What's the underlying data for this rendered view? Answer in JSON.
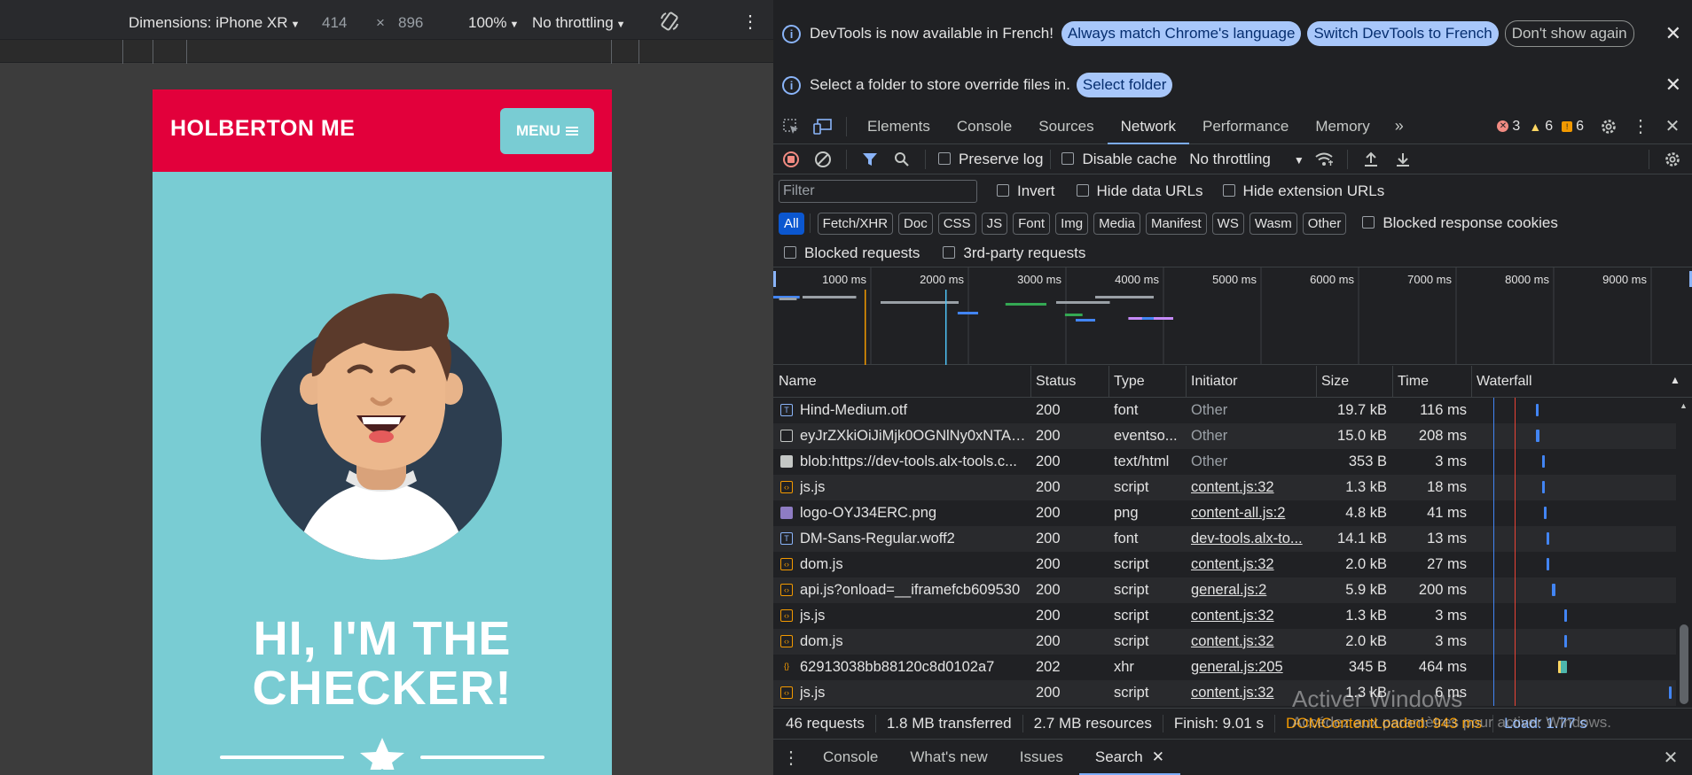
{
  "emulation": {
    "device_label": "Dimensions: iPhone XR",
    "width": "414",
    "times": "×",
    "height": "896",
    "zoom": "100%",
    "throttling": "No throttling"
  },
  "phone": {
    "brand": "HOLBERTON ME",
    "menu_label": "MENU",
    "hero_line1": "HI, I'M THE",
    "hero_line2": "CHECKER!",
    "colors": {
      "header": "#e2003b",
      "background": "#79ccd3"
    }
  },
  "infobars": {
    "language": {
      "message": "DevTools is now available in French!",
      "btn_match": "Always match Chrome's language",
      "btn_switch": "Switch DevTools to French",
      "btn_dismiss": "Don't show again"
    },
    "overrides": {
      "message": "Select a folder to store override files in.",
      "btn_select": "Select folder"
    }
  },
  "tabs": [
    "Elements",
    "Console",
    "Sources",
    "Network",
    "Performance",
    "Memory"
  ],
  "active_tab": "Network",
  "issue_counts": {
    "errors": "3",
    "warnings": "6",
    "info": "6"
  },
  "network_toolbar": {
    "preserve_log": "Preserve log",
    "disable_cache": "Disable cache",
    "throttling": "No throttling"
  },
  "filter": {
    "placeholder": "Filter",
    "invert": "Invert",
    "hide_data_urls": "Hide data URLs",
    "hide_extension_urls": "Hide extension URLs"
  },
  "type_filters": [
    "All",
    "Fetch/XHR",
    "Doc",
    "CSS",
    "JS",
    "Font",
    "Img",
    "Media",
    "Manifest",
    "WS",
    "Wasm",
    "Other"
  ],
  "blocked_response_cookies": "Blocked response cookies",
  "blocked_requests": "Blocked requests",
  "third_party_requests": "3rd-party requests",
  "overview_ticks": [
    "1000 ms",
    "2000 ms",
    "3000 ms",
    "4000 ms",
    "5000 ms",
    "6000 ms",
    "7000 ms",
    "8000 ms",
    "9000 ms"
  ],
  "columns": {
    "name": "Name",
    "status": "Status",
    "type": "Type",
    "initiator": "Initiator",
    "size": "Size",
    "time": "Time",
    "waterfall": "Waterfall"
  },
  "requests": [
    {
      "name": "Hind-Medium.otf",
      "status": "200",
      "type": "font",
      "initiator": "Other",
      "initiator_link": false,
      "size": "19.7 kB",
      "time": "116 ms",
      "icon": "font-file-icon",
      "wf_start": 1.72,
      "wf_dur": 0.116
    },
    {
      "name": "eyJrZXkiOiJiMjk0OGNlNy0xNTA2...",
      "status": "200",
      "type": "eventso...",
      "initiator": "Other",
      "initiator_link": false,
      "size": "15.0 kB",
      "time": "208 ms",
      "icon": "document-file-icon",
      "wf_start": 1.72,
      "wf_dur": 0.208
    },
    {
      "name": "blob:https://dev-tools.alx-tools.c...",
      "status": "200",
      "type": "text/html",
      "initiator": "Other",
      "initiator_link": false,
      "size": "353 B",
      "time": "3 ms",
      "icon": "blob-file-icon",
      "wf_start": 1.8,
      "wf_dur": 0.003
    },
    {
      "name": "js.js",
      "status": "200",
      "type": "script",
      "initiator": "content.js:32",
      "initiator_link": true,
      "size": "1.3 kB",
      "time": "18 ms",
      "icon": "script-file-icon",
      "wf_start": 1.8,
      "wf_dur": 0.018
    },
    {
      "name": "logo-OYJ34ERC.png",
      "status": "200",
      "type": "png",
      "initiator": "content-all.js:2",
      "initiator_link": true,
      "size": "4.8 kB",
      "time": "41 ms",
      "icon": "image-file-icon",
      "wf_start": 1.82,
      "wf_dur": 0.041
    },
    {
      "name": "DM-Sans-Regular.woff2",
      "status": "200",
      "type": "font",
      "initiator": "dev-tools.alx-to...",
      "initiator_link": true,
      "size": "14.1 kB",
      "time": "13 ms",
      "icon": "font-file-icon",
      "wf_start": 1.85,
      "wf_dur": 0.013
    },
    {
      "name": "dom.js",
      "status": "200",
      "type": "script",
      "initiator": "content.js:32",
      "initiator_link": true,
      "size": "2.0 kB",
      "time": "27 ms",
      "icon": "script-file-icon",
      "wf_start": 1.85,
      "wf_dur": 0.027
    },
    {
      "name": "api.js?onload=__iframefcb609530",
      "status": "200",
      "type": "script",
      "initiator": "general.js:2",
      "initiator_link": true,
      "size": "5.9 kB",
      "time": "200 ms",
      "icon": "script-file-icon",
      "wf_start": 1.92,
      "wf_dur": 0.2
    },
    {
      "name": "js.js",
      "status": "200",
      "type": "script",
      "initiator": "content.js:32",
      "initiator_link": true,
      "size": "1.3 kB",
      "time": "3 ms",
      "icon": "script-file-icon",
      "wf_start": 2.08,
      "wf_dur": 0.003
    },
    {
      "name": "dom.js",
      "status": "200",
      "type": "script",
      "initiator": "content.js:32",
      "initiator_link": true,
      "size": "2.0 kB",
      "time": "3 ms",
      "icon": "script-file-icon",
      "wf_start": 2.08,
      "wf_dur": 0.003
    },
    {
      "name": "62913038bb88120c8d0102a7",
      "status": "202",
      "type": "xhr",
      "initiator": "general.js:205",
      "initiator_link": true,
      "size": "345 B",
      "time": "464 ms",
      "icon": "xhr-file-icon",
      "wf_start": 2.0,
      "wf_dur": 0.464
    },
    {
      "name": "js.js",
      "status": "200",
      "type": "script",
      "initiator": "content.js:32",
      "initiator_link": true,
      "size": "1.3 kB",
      "time": "6 ms",
      "icon": "script-file-icon",
      "wf_start": 9.9,
      "wf_dur": 0.006
    }
  ],
  "summary": {
    "requests": "46 requests",
    "transferred": "1.8 MB transferred",
    "resources": "2.7 MB resources",
    "finish": "Finish: 9.01 s",
    "dcl": "DOMContentLoaded: 943 ms",
    "load": "Load: 1.77 s"
  },
  "drawer_tabs": [
    "Console",
    "What's new",
    "Issues",
    "Search"
  ],
  "active_drawer_tab": "Search",
  "watermark": {
    "line1": "Activer Windows",
    "line2": "Accédez aux paramètres pour activer Windows."
  }
}
